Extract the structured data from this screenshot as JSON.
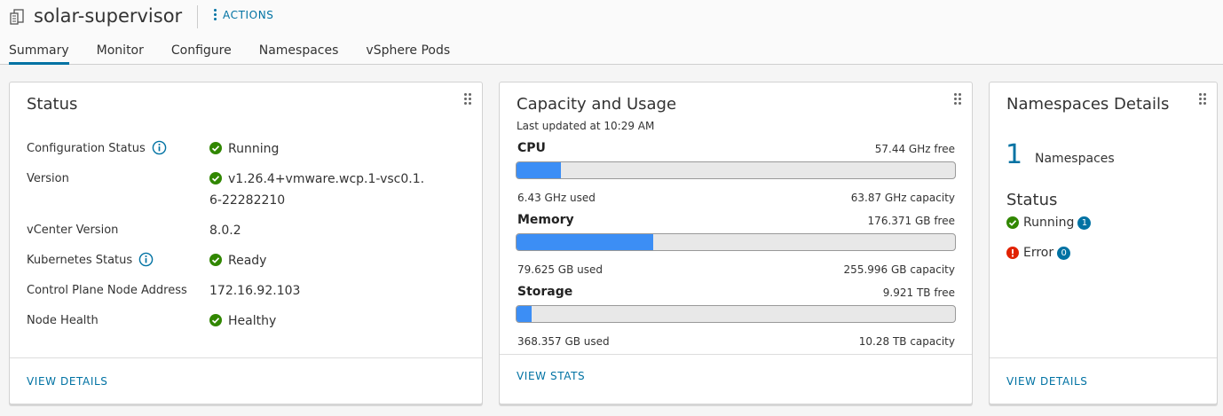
{
  "header": {
    "title": "solar-supervisor",
    "actions_label": "ACTIONS",
    "title_icon": "supervisor-cluster-icon"
  },
  "tabs": [
    {
      "label": "Summary",
      "active": true
    },
    {
      "label": "Monitor",
      "active": false
    },
    {
      "label": "Configure",
      "active": false
    },
    {
      "label": "Namespaces",
      "active": false
    },
    {
      "label": "vSphere Pods",
      "active": false
    }
  ],
  "status_card": {
    "title": "Status",
    "rows": [
      {
        "label": "Configuration Status",
        "value": "Running",
        "has_info": true,
        "has_ok": true
      },
      {
        "label": "Version",
        "value": "v1.26.4+vmware.wcp.1-vsc0.1.6-22282210",
        "has_info": false,
        "has_ok": true
      },
      {
        "label": "vCenter Version",
        "value": "8.0.2",
        "has_info": false,
        "has_ok": false
      },
      {
        "label": "Kubernetes Status",
        "value": "Ready",
        "has_info": true,
        "has_ok": true
      },
      {
        "label": "Control Plane Node Address",
        "value": "172.16.92.103",
        "has_info": false,
        "has_ok": false
      },
      {
        "label": "Node Health",
        "value": "Healthy",
        "has_info": false,
        "has_ok": true
      }
    ],
    "footer_link": "VIEW DETAILS"
  },
  "capacity_card": {
    "title": "Capacity and Usage",
    "subtitle": "Last updated at 10:29 AM",
    "resources": [
      {
        "name": "CPU",
        "free": "57.44 GHz free",
        "used": "6.43 GHz used",
        "capacity": "63.87 GHz capacity",
        "fraction": 0.1007
      },
      {
        "name": "Memory",
        "free": "176.371 GB free",
        "used": "79.625 GB used",
        "capacity": "255.996 GB capacity",
        "fraction": 0.311
      },
      {
        "name": "Storage",
        "free": "9.921 TB free",
        "used": "368.357 GB used",
        "capacity": "10.28 TB capacity",
        "fraction": 0.035
      }
    ],
    "footer_link": "VIEW STATS"
  },
  "namespaces_card": {
    "title": "Namespaces Details",
    "count": "1",
    "count_label": "Namespaces",
    "status_title": "Status",
    "running_label": "Running",
    "running_count": "1",
    "error_label": "Error",
    "error_count": "0",
    "footer_link": "VIEW DETAILS"
  },
  "colors": {
    "accent": "#0072a3",
    "bar_fill": "#3c8ef5",
    "ok_green": "#318700",
    "error_red": "#e12200"
  }
}
